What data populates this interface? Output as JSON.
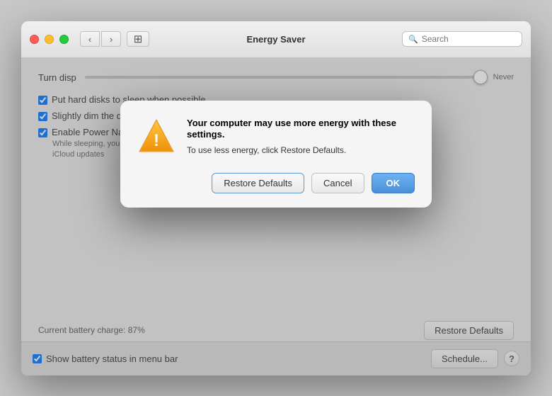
{
  "window": {
    "title": "Energy Saver"
  },
  "titlebar": {
    "back_label": "‹",
    "forward_label": "›",
    "grid_label": "⊞",
    "search_placeholder": "Search"
  },
  "main": {
    "turn_display_label": "Turn disp",
    "slider_never_label": "Never",
    "checkbox1_label": "Put hard disks to sleep when possible",
    "checkbox2_label": "Slightly dim the display while on battery power",
    "checkbox3_label": "Enable Power Nap while on battery power",
    "checkbox3_detail": "While sleeping, your Mac can periodically check for new email, calendar, and other\niCloud updates",
    "battery_charge_label": "Current battery charge: 87%",
    "restore_defaults_label": "Restore Defaults"
  },
  "footer": {
    "show_battery_label": "Show battery status in menu bar",
    "schedule_label": "Schedule...",
    "help_label": "?"
  },
  "dialog": {
    "title": "Your computer may use more energy with\nthese settings.",
    "subtitle": "To use less energy, click Restore Defaults.",
    "restore_label": "Restore Defaults",
    "cancel_label": "Cancel",
    "ok_label": "OK"
  }
}
